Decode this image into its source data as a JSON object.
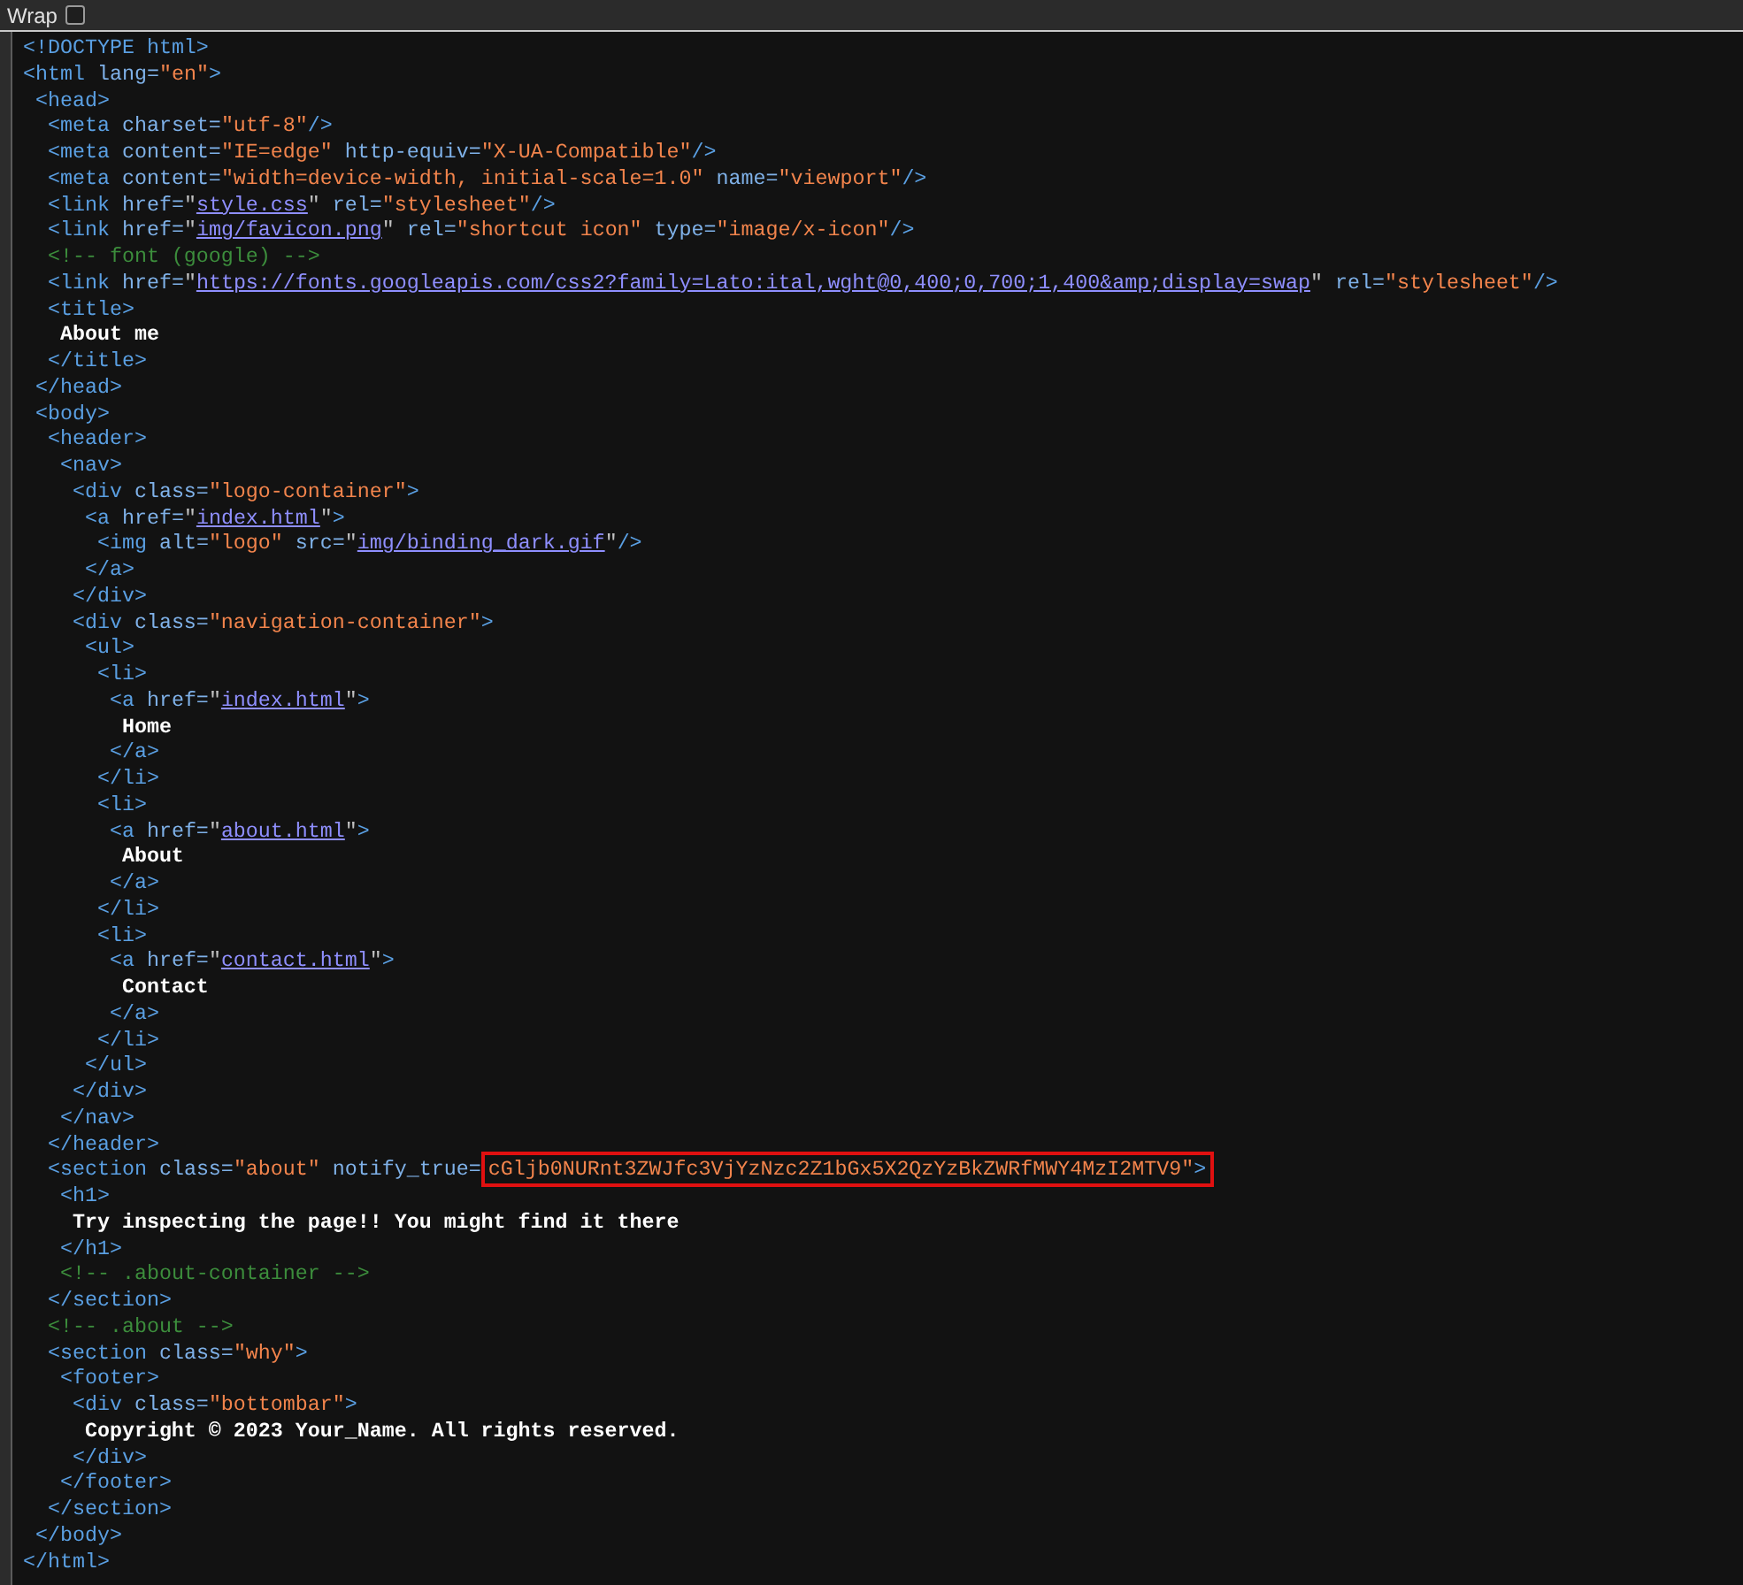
{
  "wrap_option": {
    "label": "Wrap",
    "checked": false
  },
  "source_lines": [
    {
      "segs": [
        {
          "kind": "tag",
          "text": "<!DOCTYPE html>"
        }
      ]
    },
    {
      "segs": [
        {
          "kind": "tag",
          "text": "<html "
        },
        {
          "kind": "attr",
          "text": "lang="
        },
        {
          "kind": "value",
          "text": "\"en\""
        },
        {
          "kind": "tag",
          "text": ">"
        }
      ],
      "children": [
        {
          "segs": [
            {
              "kind": "tag",
              "text": "<head>"
            }
          ],
          "children": [
            {
              "segs": [
                {
                  "kind": "tag",
                  "text": "<meta "
                },
                {
                  "kind": "attr",
                  "text": "charset="
                },
                {
                  "kind": "value",
                  "text": "\"utf-8\""
                },
                {
                  "kind": "tag",
                  "text": "/>"
                }
              ]
            },
            {
              "segs": [
                {
                  "kind": "tag",
                  "text": "<meta "
                },
                {
                  "kind": "attr",
                  "text": "content="
                },
                {
                  "kind": "value",
                  "text": "\"IE=edge\""
                },
                {
                  "kind": "attr",
                  "text": " http-equiv="
                },
                {
                  "kind": "value",
                  "text": "\"X-UA-Compatible\""
                },
                {
                  "kind": "tag",
                  "text": "/>"
                }
              ]
            },
            {
              "segs": [
                {
                  "kind": "tag",
                  "text": "<meta "
                },
                {
                  "kind": "attr",
                  "text": "content="
                },
                {
                  "kind": "value",
                  "text": "\"width=device-width, initial-scale=1.0\""
                },
                {
                  "kind": "attr",
                  "text": " name="
                },
                {
                  "kind": "value",
                  "text": "\"viewport\""
                },
                {
                  "kind": "tag",
                  "text": "/>"
                }
              ]
            },
            {
              "segs": [
                {
                  "kind": "tag",
                  "text": "<link "
                },
                {
                  "kind": "attr",
                  "text": "href="
                },
                {
                  "kind": "punct",
                  "text": "\""
                },
                {
                  "kind": "link",
                  "text": "style.css"
                },
                {
                  "kind": "punct",
                  "text": "\""
                },
                {
                  "kind": "attr",
                  "text": " rel="
                },
                {
                  "kind": "value",
                  "text": "\"stylesheet\""
                },
                {
                  "kind": "tag",
                  "text": "/>"
                }
              ]
            },
            {
              "segs": [
                {
                  "kind": "tag",
                  "text": "<link "
                },
                {
                  "kind": "attr",
                  "text": "href="
                },
                {
                  "kind": "punct",
                  "text": "\""
                },
                {
                  "kind": "link",
                  "text": "img/favicon.png"
                },
                {
                  "kind": "punct",
                  "text": "\""
                },
                {
                  "kind": "attr",
                  "text": " rel="
                },
                {
                  "kind": "value",
                  "text": "\"shortcut icon\""
                },
                {
                  "kind": "attr",
                  "text": " type="
                },
                {
                  "kind": "value",
                  "text": "\"image/x-icon\""
                },
                {
                  "kind": "tag",
                  "text": "/>"
                }
              ]
            },
            {
              "segs": [
                {
                  "kind": "comment",
                  "text": "<!-- font (google) -->"
                }
              ]
            },
            {
              "segs": [
                {
                  "kind": "tag",
                  "text": "<link "
                },
                {
                  "kind": "attr",
                  "text": "href="
                },
                {
                  "kind": "punct",
                  "text": "\""
                },
                {
                  "kind": "link",
                  "text": "https://fonts.googleapis.com/css2?family=Lato:ital,wght@0,400;0,700;1,400&amp;display=swap"
                },
                {
                  "kind": "punct",
                  "text": "\""
                },
                {
                  "kind": "attr",
                  "text": " rel="
                },
                {
                  "kind": "value",
                  "text": "\"stylesheet\""
                },
                {
                  "kind": "tag",
                  "text": "/>"
                }
              ]
            },
            {
              "segs": [
                {
                  "kind": "tag",
                  "text": "<title>"
                }
              ],
              "children": [
                {
                  "segs": [
                    {
                      "kind": "text",
                      "text": "About me"
                    }
                  ]
                }
              ]
            },
            {
              "segs": [
                {
                  "kind": "tag",
                  "text": "</title>"
                }
              ]
            }
          ]
        },
        {
          "segs": [
            {
              "kind": "tag",
              "text": "</head>"
            }
          ]
        },
        {
          "segs": [
            {
              "kind": "tag",
              "text": "<body>"
            }
          ],
          "children": [
            {
              "segs": [
                {
                  "kind": "tag",
                  "text": "<header>"
                }
              ],
              "children": [
                {
                  "segs": [
                    {
                      "kind": "tag",
                      "text": "<nav>"
                    }
                  ],
                  "children": [
                    {
                      "segs": [
                        {
                          "kind": "tag",
                          "text": "<div "
                        },
                        {
                          "kind": "attr",
                          "text": "class="
                        },
                        {
                          "kind": "value",
                          "text": "\"logo-container\""
                        },
                        {
                          "kind": "tag",
                          "text": ">"
                        }
                      ],
                      "children": [
                        {
                          "segs": [
                            {
                              "kind": "tag",
                              "text": "<a "
                            },
                            {
                              "kind": "attr",
                              "text": "href="
                            },
                            {
                              "kind": "punct",
                              "text": "\""
                            },
                            {
                              "kind": "link",
                              "text": "index.html"
                            },
                            {
                              "kind": "punct",
                              "text": "\""
                            },
                            {
                              "kind": "tag",
                              "text": ">"
                            }
                          ],
                          "children": [
                            {
                              "segs": [
                                {
                                  "kind": "tag",
                                  "text": "<img "
                                },
                                {
                                  "kind": "attr",
                                  "text": "alt="
                                },
                                {
                                  "kind": "value",
                                  "text": "\"logo\""
                                },
                                {
                                  "kind": "attr",
                                  "text": " src="
                                },
                                {
                                  "kind": "punct",
                                  "text": "\""
                                },
                                {
                                  "kind": "link",
                                  "text": "img/binding_dark.gif"
                                },
                                {
                                  "kind": "punct",
                                  "text": "\""
                                },
                                {
                                  "kind": "tag",
                                  "text": "/>"
                                }
                              ]
                            }
                          ]
                        },
                        {
                          "segs": [
                            {
                              "kind": "tag",
                              "text": "</a>"
                            }
                          ]
                        }
                      ]
                    },
                    {
                      "segs": [
                        {
                          "kind": "tag",
                          "text": "</div>"
                        }
                      ]
                    },
                    {
                      "segs": [
                        {
                          "kind": "tag",
                          "text": "<div "
                        },
                        {
                          "kind": "attr",
                          "text": "class="
                        },
                        {
                          "kind": "value",
                          "text": "\"navigation-container\""
                        },
                        {
                          "kind": "tag",
                          "text": ">"
                        }
                      ],
                      "children": [
                        {
                          "segs": [
                            {
                              "kind": "tag",
                              "text": "<ul>"
                            }
                          ],
                          "children": [
                            {
                              "segs": [
                                {
                                  "kind": "tag",
                                  "text": "<li>"
                                }
                              ],
                              "children": [
                                {
                                  "segs": [
                                    {
                                      "kind": "tag",
                                      "text": "<a "
                                    },
                                    {
                                      "kind": "attr",
                                      "text": "href="
                                    },
                                    {
                                      "kind": "punct",
                                      "text": "\""
                                    },
                                    {
                                      "kind": "link",
                                      "text": "index.html"
                                    },
                                    {
                                      "kind": "punct",
                                      "text": "\""
                                    },
                                    {
                                      "kind": "tag",
                                      "text": ">"
                                    }
                                  ],
                                  "children": [
                                    {
                                      "segs": [
                                        {
                                          "kind": "text",
                                          "text": "Home"
                                        }
                                      ]
                                    }
                                  ]
                                },
                                {
                                  "segs": [
                                    {
                                      "kind": "tag",
                                      "text": "</a>"
                                    }
                                  ]
                                }
                              ]
                            },
                            {
                              "segs": [
                                {
                                  "kind": "tag",
                                  "text": "</li>"
                                }
                              ]
                            },
                            {
                              "segs": [
                                {
                                  "kind": "tag",
                                  "text": "<li>"
                                }
                              ],
                              "children": [
                                {
                                  "segs": [
                                    {
                                      "kind": "tag",
                                      "text": "<a "
                                    },
                                    {
                                      "kind": "attr",
                                      "text": "href="
                                    },
                                    {
                                      "kind": "punct",
                                      "text": "\""
                                    },
                                    {
                                      "kind": "link",
                                      "text": "about.html"
                                    },
                                    {
                                      "kind": "punct",
                                      "text": "\""
                                    },
                                    {
                                      "kind": "tag",
                                      "text": ">"
                                    }
                                  ],
                                  "children": [
                                    {
                                      "segs": [
                                        {
                                          "kind": "text",
                                          "text": "About"
                                        }
                                      ]
                                    }
                                  ]
                                },
                                {
                                  "segs": [
                                    {
                                      "kind": "tag",
                                      "text": "</a>"
                                    }
                                  ]
                                }
                              ]
                            },
                            {
                              "segs": [
                                {
                                  "kind": "tag",
                                  "text": "</li>"
                                }
                              ]
                            },
                            {
                              "segs": [
                                {
                                  "kind": "tag",
                                  "text": "<li>"
                                }
                              ],
                              "children": [
                                {
                                  "segs": [
                                    {
                                      "kind": "tag",
                                      "text": "<a "
                                    },
                                    {
                                      "kind": "attr",
                                      "text": "href="
                                    },
                                    {
                                      "kind": "punct",
                                      "text": "\""
                                    },
                                    {
                                      "kind": "link",
                                      "text": "contact.html"
                                    },
                                    {
                                      "kind": "punct",
                                      "text": "\""
                                    },
                                    {
                                      "kind": "tag",
                                      "text": ">"
                                    }
                                  ],
                                  "children": [
                                    {
                                      "segs": [
                                        {
                                          "kind": "text",
                                          "text": "Contact"
                                        }
                                      ]
                                    }
                                  ]
                                },
                                {
                                  "segs": [
                                    {
                                      "kind": "tag",
                                      "text": "</a>"
                                    }
                                  ]
                                }
                              ]
                            },
                            {
                              "segs": [
                                {
                                  "kind": "tag",
                                  "text": "</li>"
                                }
                              ]
                            }
                          ]
                        },
                        {
                          "segs": [
                            {
                              "kind": "tag",
                              "text": "</ul>"
                            }
                          ]
                        }
                      ]
                    },
                    {
                      "segs": [
                        {
                          "kind": "tag",
                          "text": "</div>"
                        }
                      ]
                    }
                  ]
                },
                {
                  "segs": [
                    {
                      "kind": "tag",
                      "text": "</nav>"
                    }
                  ]
                }
              ]
            },
            {
              "segs": [
                {
                  "kind": "tag",
                  "text": "</header>"
                }
              ]
            },
            {
              "segs": [
                {
                  "kind": "tag",
                  "text": "<section "
                },
                {
                  "kind": "attr",
                  "text": "class="
                },
                {
                  "kind": "value",
                  "text": "\"about\""
                },
                {
                  "kind": "attr",
                  "text": " notify_true= "
                }
              ],
              "marked": [
                {
                  "kind": "value",
                  "text": "cGljb0NURnt3ZWJfc3VjYzNzc2Z1bGx5X2QzYzBkZWRfMWY4MzI2MTV9\""
                },
                {
                  "kind": "tag",
                  "text": ">"
                }
              ],
              "children": [
                {
                  "segs": [
                    {
                      "kind": "tag",
                      "text": "<h1>"
                    }
                  ],
                  "children": [
                    {
                      "segs": [
                        {
                          "kind": "text",
                          "text": "Try inspecting the page!! You might find it there"
                        }
                      ]
                    }
                  ]
                },
                {
                  "segs": [
                    {
                      "kind": "tag",
                      "text": "</h1>"
                    }
                  ]
                },
                {
                  "segs": [
                    {
                      "kind": "comment",
                      "text": "<!-- .about-container -->"
                    }
                  ]
                }
              ]
            },
            {
              "segs": [
                {
                  "kind": "tag",
                  "text": "</section>"
                }
              ]
            },
            {
              "segs": [
                {
                  "kind": "comment",
                  "text": "<!-- .about -->"
                }
              ]
            },
            {
              "segs": [
                {
                  "kind": "tag",
                  "text": "<section "
                },
                {
                  "kind": "attr",
                  "text": "class="
                },
                {
                  "kind": "value",
                  "text": "\"why\""
                },
                {
                  "kind": "tag",
                  "text": ">"
                }
              ],
              "children": [
                {
                  "segs": [
                    {
                      "kind": "tag",
                      "text": "<footer>"
                    }
                  ],
                  "children": [
                    {
                      "segs": [
                        {
                          "kind": "tag",
                          "text": "<div "
                        },
                        {
                          "kind": "attr",
                          "text": "class="
                        },
                        {
                          "kind": "value",
                          "text": "\"bottombar\""
                        },
                        {
                          "kind": "tag",
                          "text": ">"
                        }
                      ],
                      "children": [
                        {
                          "segs": [
                            {
                              "kind": "text",
                              "text": "Copyright © 2023 Your_Name. All rights reserved."
                            }
                          ]
                        }
                      ]
                    },
                    {
                      "segs": [
                        {
                          "kind": "tag",
                          "text": "</div>"
                        }
                      ]
                    }
                  ]
                },
                {
                  "segs": [
                    {
                      "kind": "tag",
                      "text": "</footer>"
                    }
                  ]
                }
              ]
            },
            {
              "segs": [
                {
                  "kind": "tag",
                  "text": "</section>"
                }
              ]
            }
          ]
        },
        {
          "segs": [
            {
              "kind": "tag",
              "text": "</body>"
            }
          ]
        }
      ]
    },
    {
      "segs": [
        {
          "kind": "tag",
          "text": "</html>"
        }
      ]
    }
  ]
}
